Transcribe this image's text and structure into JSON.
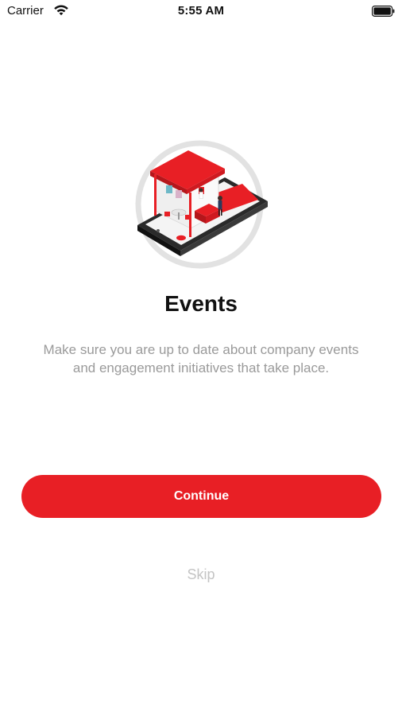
{
  "status_bar": {
    "carrier": "Carrier",
    "time": "5:55 AM",
    "wifi_icon": "wifi-icon",
    "battery_icon": "battery-icon"
  },
  "onboarding": {
    "illustration": "events-booth-on-phone-illustration",
    "title": "Events",
    "description": "Make sure you are up to date about company events and engagement initiatives that take place.",
    "continue_label": "Continue",
    "skip_label": "Skip"
  },
  "colors": {
    "accent": "#e81f25",
    "description_text": "#9a9a9a",
    "skip_text": "#c4c4c4",
    "background": "#ffffff"
  }
}
